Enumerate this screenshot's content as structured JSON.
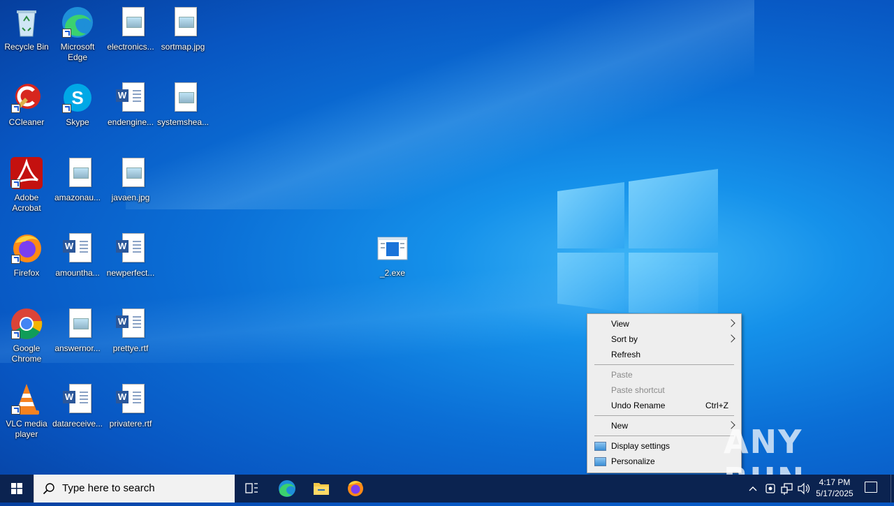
{
  "desktop": {
    "icons": [
      {
        "label": "Recycle Bin"
      },
      {
        "label": "Microsoft Edge"
      },
      {
        "label": "electronics..."
      },
      {
        "label": "sortmap.jpg"
      },
      {
        "label": "CCleaner"
      },
      {
        "label": "Skype"
      },
      {
        "label": "endengine..."
      },
      {
        "label": "systemshea..."
      },
      {
        "label": "Adobe Acrobat"
      },
      {
        "label": "amazonau..."
      },
      {
        "label": "javaen.jpg"
      },
      {
        "label": "Firefox"
      },
      {
        "label": "amountha..."
      },
      {
        "label": "newperfect..."
      },
      {
        "label": "Google Chrome"
      },
      {
        "label": "answernor..."
      },
      {
        "label": "prettye.rtf"
      },
      {
        "label": "VLC media player"
      },
      {
        "label": "datareceive..."
      },
      {
        "label": "privatere.rtf"
      },
      {
        "label": "_2.exe"
      }
    ]
  },
  "context_menu": {
    "items": [
      {
        "label": "View"
      },
      {
        "label": "Sort by"
      },
      {
        "label": "Refresh"
      },
      {
        "label": "Paste"
      },
      {
        "label": "Paste shortcut"
      },
      {
        "label": "Undo Rename",
        "shortcut": "Ctrl+Z"
      },
      {
        "label": "New"
      },
      {
        "label": "Display settings"
      },
      {
        "label": "Personalize"
      }
    ]
  },
  "taskbar": {
    "search_placeholder": "Type here to search",
    "time": "4:17 PM",
    "date": "5/17/2025"
  },
  "watermark": {
    "text": "ANY RUN"
  }
}
